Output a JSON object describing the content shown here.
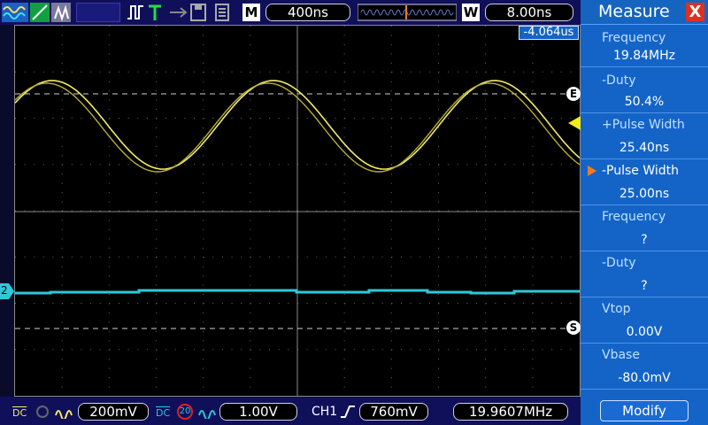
{
  "top_bar": {
    "m_label": "M",
    "timebase": "400ns",
    "w_label": "W",
    "window_time": "8.00ns"
  },
  "trigger_position": "-4.064us",
  "markers": {
    "ch1_ref": "E",
    "ch2_ref": "S",
    "ch2_ground": "2"
  },
  "measure": {
    "title": "Measure",
    "close": "X",
    "items": [
      {
        "label": "Frequency",
        "value": "19.84MHz"
      },
      {
        "label": "-Duty",
        "value": "50.4%"
      },
      {
        "label": "+Pulse Width",
        "value": "25.40ns"
      },
      {
        "label": "-Pulse Width",
        "value": "25.00ns"
      },
      {
        "label": "Frequency",
        "value": "?"
      },
      {
        "label": "-Duty",
        "value": "?"
      },
      {
        "label": "Vtop",
        "value": "0.00V"
      },
      {
        "label": "Vbase",
        "value": "-80.0mV"
      }
    ],
    "modify_label": "Modify"
  },
  "bottom_bar": {
    "ch1_coupling": "DC",
    "ch1_scale": "200mV",
    "ch2_coupling": "DC",
    "ch2_bw": "20",
    "ch2_scale": "1.00V",
    "trigger_source": "CH1",
    "trigger_level": "760mV",
    "frequency": "19.9607MHz"
  },
  "colors": {
    "ch1": "#f2ea6a",
    "ch2": "#2ec8d8",
    "accent": "#1464c8",
    "selected_arrow": "#ff7a1a"
  }
}
